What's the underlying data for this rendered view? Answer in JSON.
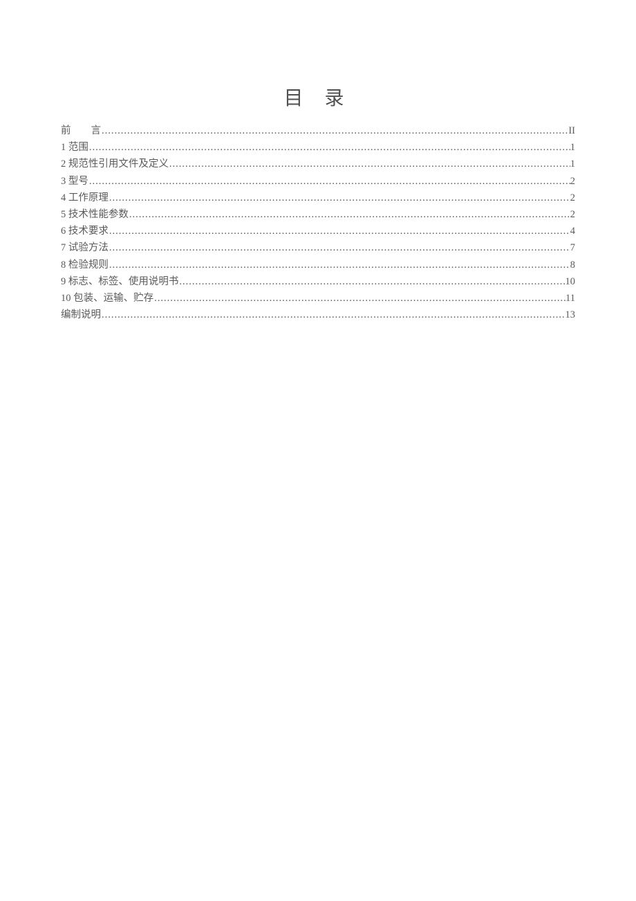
{
  "title": "目 录",
  "toc": {
    "items": [
      {
        "label": "前  言",
        "page": "II"
      },
      {
        "label": "1 范围",
        "page": "1"
      },
      {
        "label": "2 规范性引用文件及定义",
        "page": "1"
      },
      {
        "label": "3 型号",
        "page": "2"
      },
      {
        "label": "4 工作原理",
        "page": "2"
      },
      {
        "label": "5 技术性能参数",
        "page": "2"
      },
      {
        "label": "6 技术要求",
        "page": "4"
      },
      {
        "label": "7 试验方法",
        "page": "7"
      },
      {
        "label": "8 检验规则",
        "page": "8"
      },
      {
        "label": "9 标志、标签、使用说明书",
        "page": "10"
      },
      {
        "label": "10 包装、运输、贮存",
        "page": "11"
      },
      {
        "label": "编制说明",
        "page": "13"
      }
    ]
  }
}
